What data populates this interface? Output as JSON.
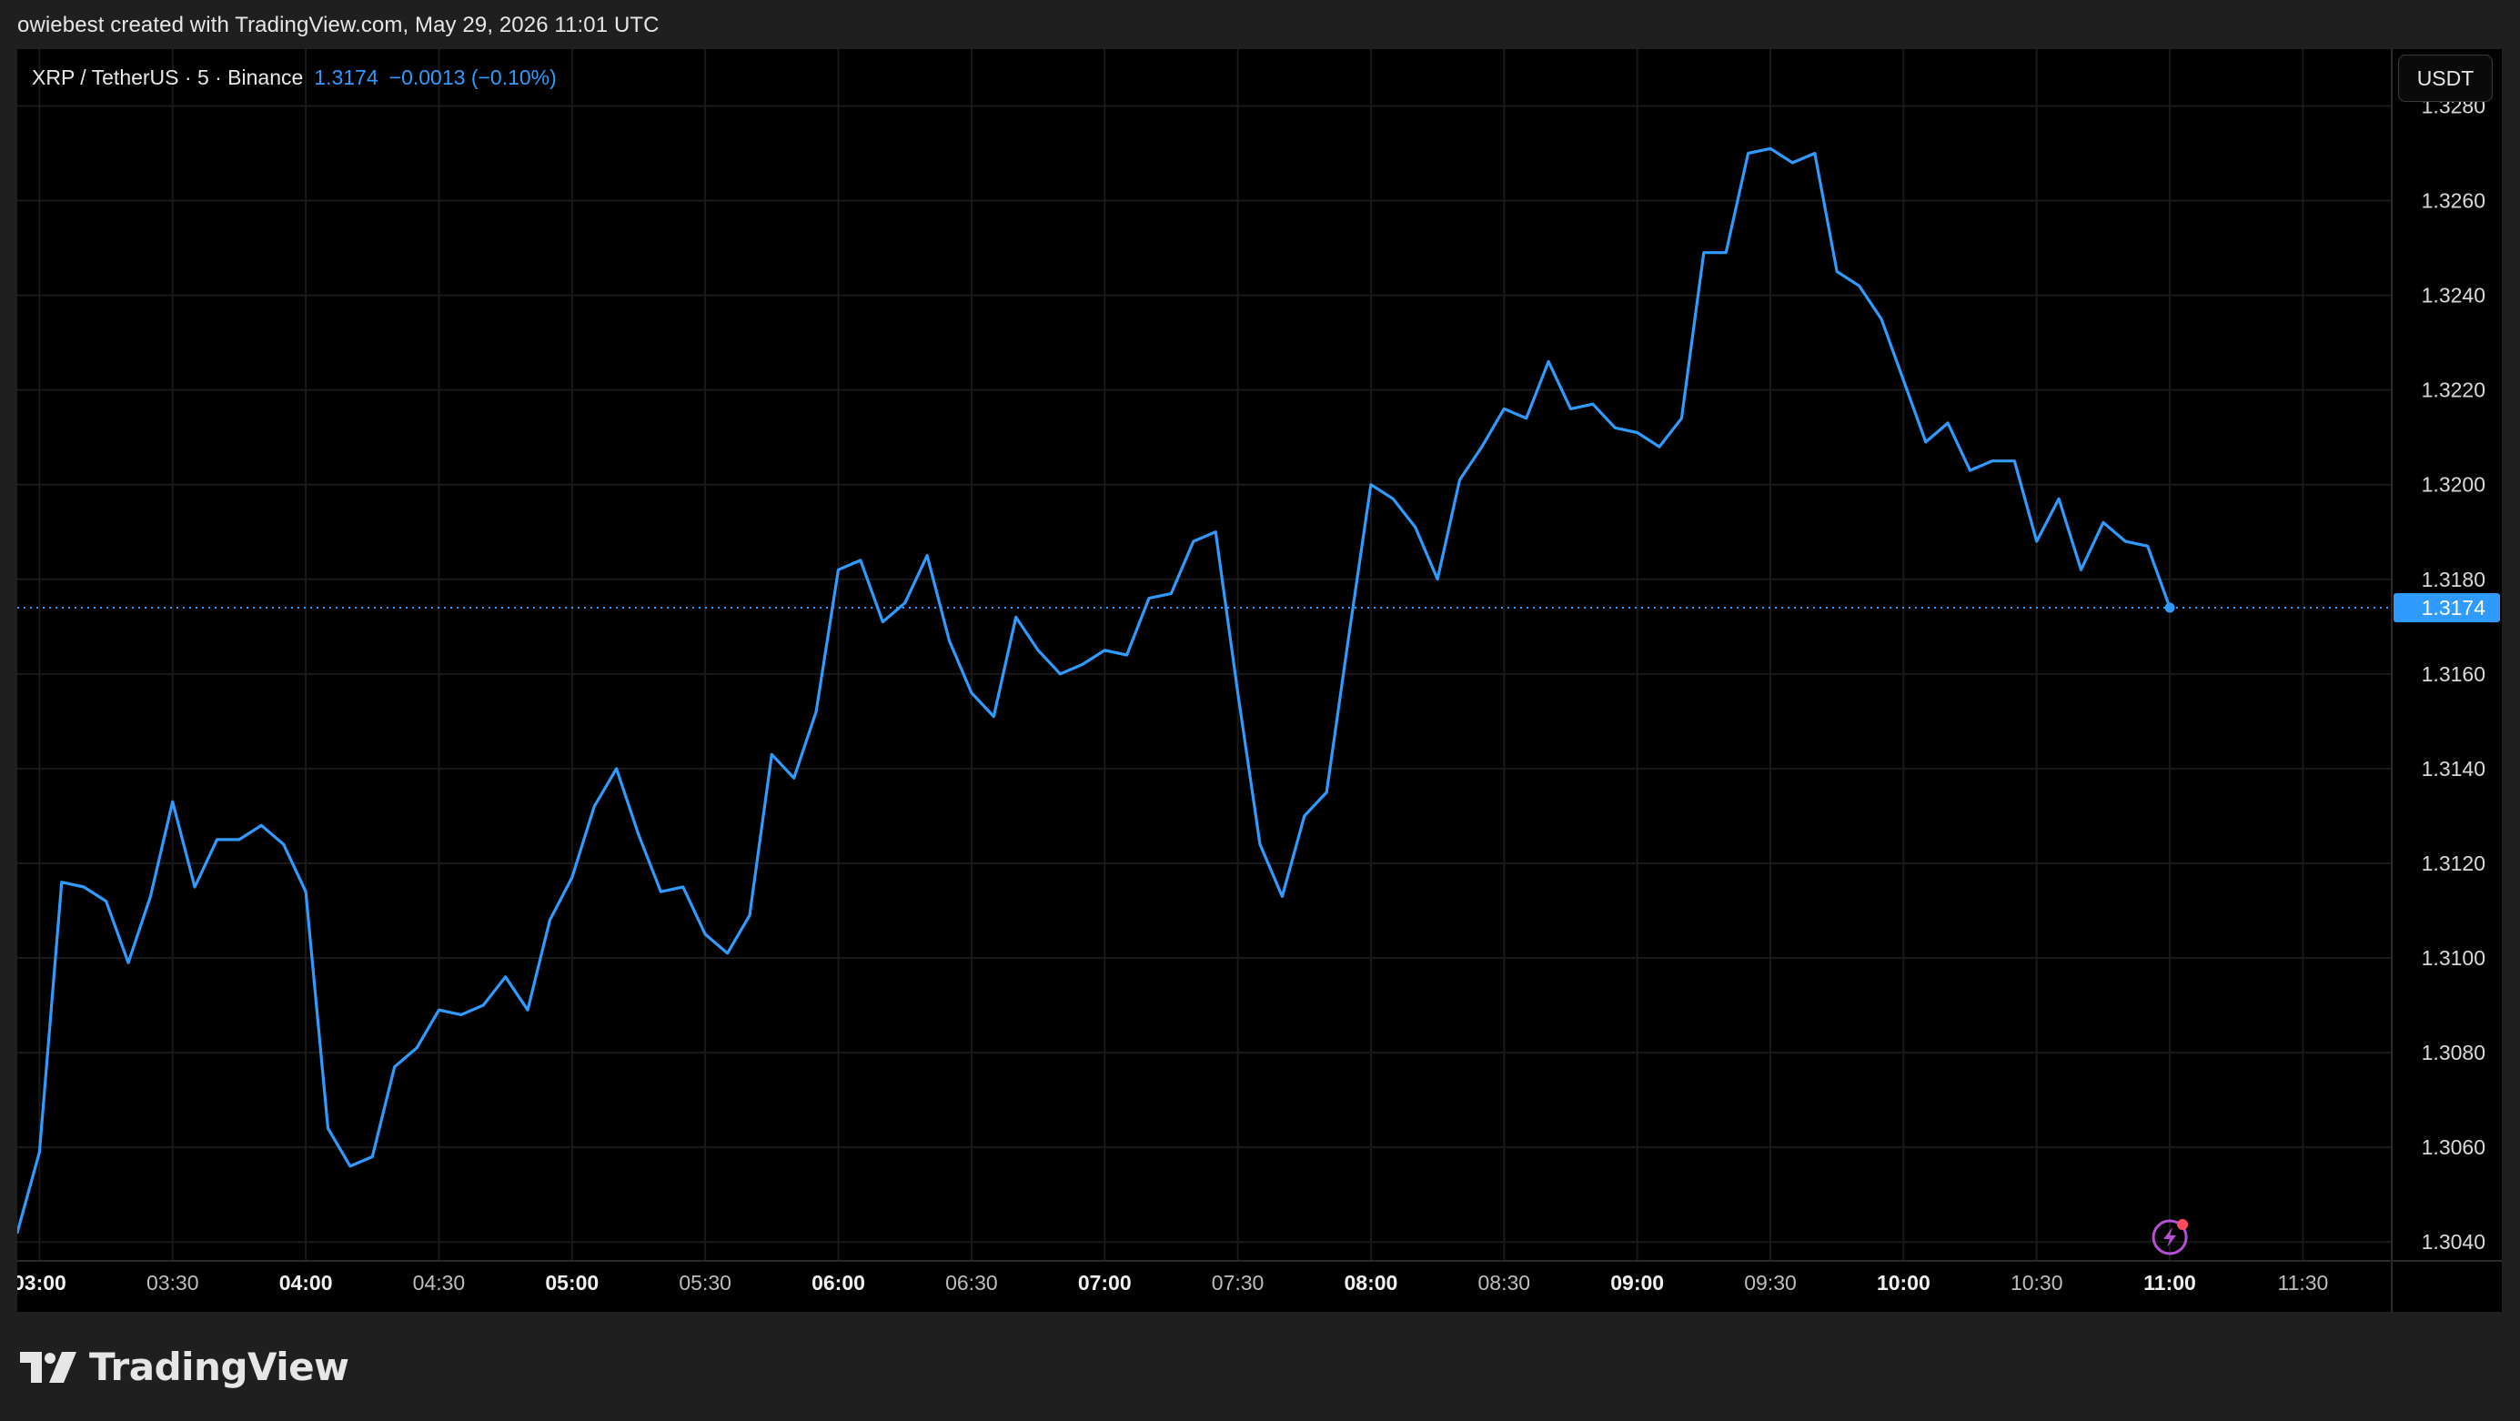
{
  "header": {
    "created_text": "owiebest created with TradingView.com, May 29, 2026 11:01 UTC"
  },
  "legend": {
    "symbol": "XRP / TetherUS · 5 · Binance",
    "price": "1.3174",
    "change": "−0.0013 (−0.10%)"
  },
  "currency_button": "USDT",
  "brand": {
    "name": "TradingView"
  },
  "colors": {
    "line": "#2f9bff",
    "grid": "#1a1a1a",
    "label_bg": "#2f9bff",
    "alert_icon": "#b64fd6"
  },
  "chart_data": {
    "type": "line",
    "title": "XRP / TetherUS · 5 · Binance",
    "interval_minutes": 5,
    "x_start": "02:55",
    "x_end": "11:00",
    "xlim": [
      "02:55",
      "11:50"
    ],
    "ylim": [
      1.3036,
      1.3292
    ],
    "y_ticks": [
      "1.3040",
      "1.3060",
      "1.3080",
      "1.3100",
      "1.3120",
      "1.3140",
      "1.3160",
      "1.3180",
      "1.3200",
      "1.3220",
      "1.3240",
      "1.3260",
      "1.3280"
    ],
    "x_ticks": [
      {
        "label": "03:00",
        "time": "03:00",
        "major": true
      },
      {
        "label": "03:30",
        "time": "03:30",
        "major": false
      },
      {
        "label": "04:00",
        "time": "04:00",
        "major": true
      },
      {
        "label": "04:30",
        "time": "04:30",
        "major": false
      },
      {
        "label": "05:00",
        "time": "05:00",
        "major": true
      },
      {
        "label": "05:30",
        "time": "05:30",
        "major": false
      },
      {
        "label": "06:00",
        "time": "06:00",
        "major": true
      },
      {
        "label": "06:30",
        "time": "06:30",
        "major": false
      },
      {
        "label": "07:00",
        "time": "07:00",
        "major": true
      },
      {
        "label": "07:30",
        "time": "07:30",
        "major": false
      },
      {
        "label": "08:00",
        "time": "08:00",
        "major": true
      },
      {
        "label": "08:30",
        "time": "08:30",
        "major": false
      },
      {
        "label": "09:00",
        "time": "09:00",
        "major": true
      },
      {
        "label": "09:30",
        "time": "09:30",
        "major": false
      },
      {
        "label": "10:00",
        "time": "10:00",
        "major": true
      },
      {
        "label": "10:30",
        "time": "10:30",
        "major": false
      },
      {
        "label": "11:00",
        "time": "11:00",
        "major": true
      },
      {
        "label": "11:30",
        "time": "11:30",
        "major": false
      }
    ],
    "values": [
      1.3042,
      1.3059,
      1.3116,
      1.3115,
      1.3112,
      1.3099,
      1.3113,
      1.3133,
      1.3115,
      1.3125,
      1.3125,
      1.3128,
      1.3124,
      1.3114,
      1.3064,
      1.3056,
      1.3058,
      1.3077,
      1.3081,
      1.3089,
      1.3088,
      1.309,
      1.3096,
      1.3089,
      1.3108,
      1.3117,
      1.3132,
      1.314,
      1.3126,
      1.3114,
      1.3115,
      1.3105,
      1.3101,
      1.3109,
      1.3143,
      1.3138,
      1.3152,
      1.3182,
      1.3184,
      1.3171,
      1.3175,
      1.3185,
      1.3167,
      1.3156,
      1.3151,
      1.3172,
      1.3165,
      1.316,
      1.3162,
      1.3165,
      1.3164,
      1.3176,
      1.3177,
      1.3188,
      1.319,
      1.3156,
      1.3124,
      1.3113,
      1.313,
      1.3135,
      1.3168,
      1.32,
      1.3197,
      1.3191,
      1.318,
      1.3201,
      1.3208,
      1.3216,
      1.3214,
      1.3226,
      1.3216,
      1.3217,
      1.3212,
      1.3211,
      1.3208,
      1.3214,
      1.3249,
      1.3249,
      1.327,
      1.3271,
      1.3268,
      1.327,
      1.3245,
      1.3242,
      1.3235,
      1.3222,
      1.3209,
      1.3213,
      1.3203,
      1.3205,
      1.3205,
      1.3188,
      1.3197,
      1.3182,
      1.3192,
      1.3188,
      1.3187,
      1.3174
    ],
    "last_price_label": "1.3174",
    "grid": true
  }
}
